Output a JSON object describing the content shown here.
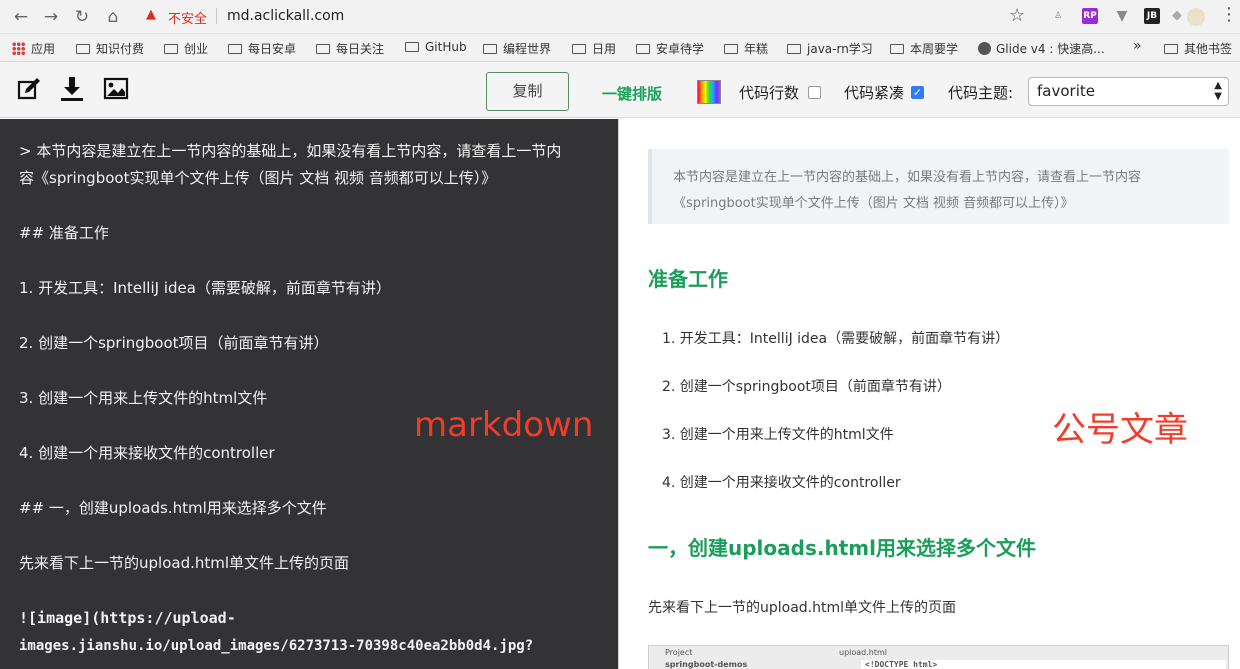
{
  "browser": {
    "security_label": "不安全",
    "url": "md.aclickall.com"
  },
  "bookmarks": [
    "应用",
    "知识付费",
    "创业",
    "每日安卓",
    "每日关注",
    "GitHub",
    "编程世界",
    "日用",
    "安卓待学",
    "年糕",
    "java-rn学习",
    "本周要学",
    "Glide v4 : 快速高...",
    "其他书签"
  ],
  "toolbar": {
    "copy_label": "复制",
    "format_label": "一键排版",
    "line_numbers_label": "代码行数",
    "compact_label": "代码紧凑",
    "theme_label": "代码主题:",
    "theme_value": "favorite"
  },
  "editor": {
    "lines": [
      "> 本节内容是建立在上一节内容的基础上，如果没有看上节内容，请查看上一节内",
      "容《springboot实现单个文件上传（图片 文档 视频 音频都可以上传）》",
      "## 准备工作",
      "1.  开发工具：IntelliJ idea（需要破解，前面章节有讲）",
      "2.  创建一个springboot项目（前面章节有讲）",
      "3.  创建一个用来上传文件的html文件",
      "4.  创建一个用来接收文件的controller",
      "## 一，创建uploads.html用来选择多个文件",
      "先来看下上一节的upload.html单文件上传的页面",
      "![image](https://upload-",
      "images.jianshu.io/upload_images/6273713-70398c40ea2bb0d4.jpg?"
    ],
    "overlay": "markdown"
  },
  "preview": {
    "quote_lines": [
      "本节内容是建立在上一节内容的基础上，如果没有看上节内容，请查看上一节内容",
      "《springboot实现单个文件上传（图片 文档 视频 音频都可以上传）》"
    ],
    "heading1": "准备工作",
    "list": [
      "1. 开发工具：IntelliJ idea（需要破解，前面章节有讲）",
      "2. 创建一个springboot项目（前面章节有讲）",
      "3. 创建一个用来上传文件的html文件",
      "4. 创建一个用来接收文件的controller"
    ],
    "heading2": "一，创建uploads.html用来选择多个文件",
    "paragraph": "先来看下上一节的upload.html单文件上传的页面",
    "overlay": "公号文章",
    "image_strip": {
      "project_label": "Project",
      "tab_label": "upload.html",
      "tree_label": "springboot-demos",
      "code_line": "<!DOCTYPE html>"
    }
  }
}
